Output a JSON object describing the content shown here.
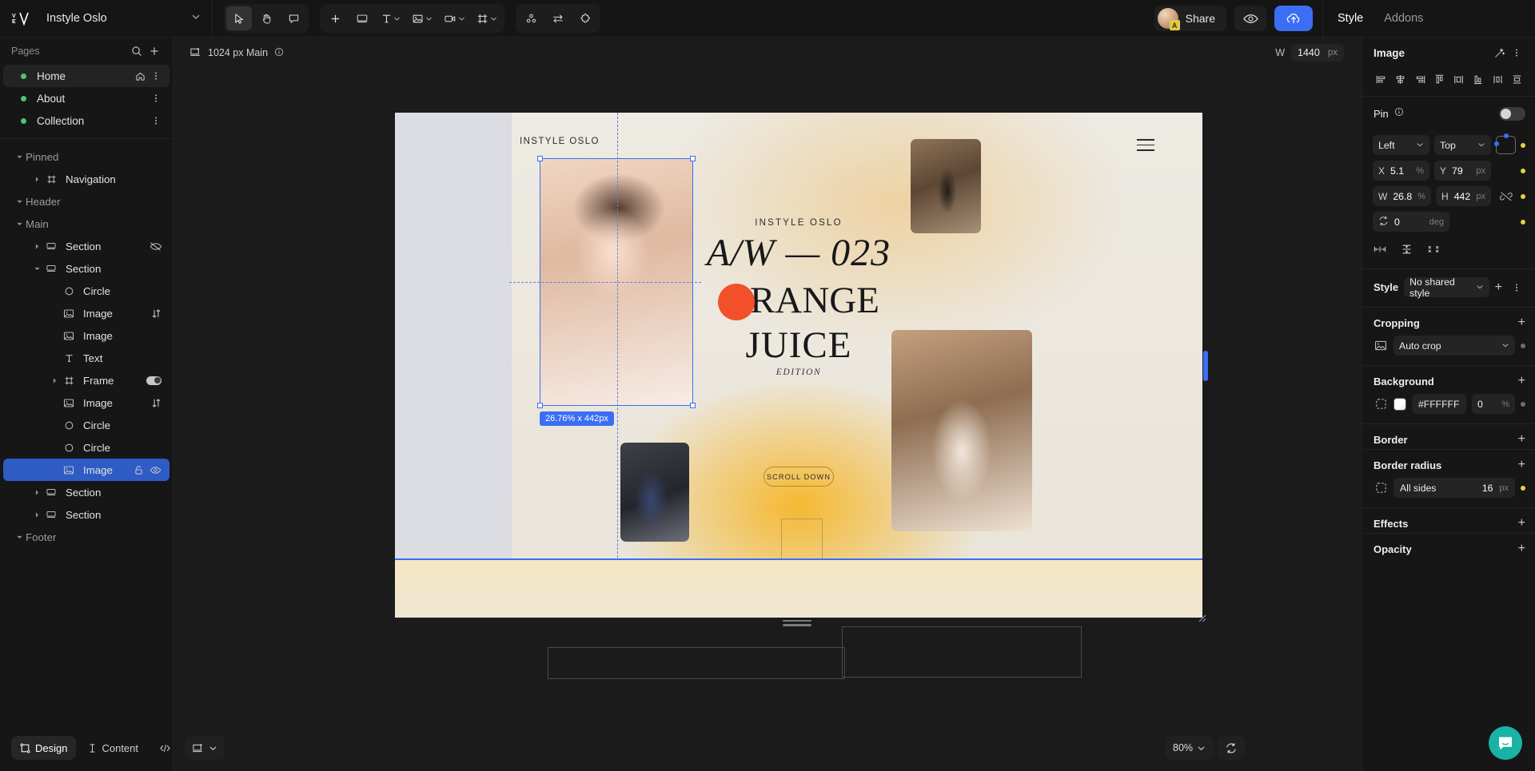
{
  "app": {
    "project_name": "Instyle Oslo",
    "logo_text": "V"
  },
  "toolbar": {
    "tools": [
      {
        "name": "select-tool",
        "icon": "cursor-icon",
        "active": true
      },
      {
        "name": "hand-tool",
        "icon": "hand-icon",
        "active": false
      },
      {
        "name": "comment-tool",
        "icon": "comment-icon",
        "active": false
      }
    ],
    "inserts": [
      {
        "name": "add-element-button",
        "icon": "plus-icon",
        "caret": false
      },
      {
        "name": "insert-section-button",
        "icon": "section-icon",
        "caret": false
      },
      {
        "name": "insert-text-button",
        "icon": "text-icon",
        "caret": true
      },
      {
        "name": "insert-image-button",
        "icon": "image-icon",
        "caret": true
      },
      {
        "name": "insert-video-button",
        "icon": "video-icon",
        "caret": true
      },
      {
        "name": "insert-frame-button",
        "icon": "frame-icon",
        "caret": true
      }
    ],
    "extras": [
      {
        "name": "components-button",
        "icon": "components-icon"
      },
      {
        "name": "interactions-button",
        "icon": "swap-arrows-icon"
      },
      {
        "name": "plugins-button",
        "icon": "puzzle-icon"
      }
    ],
    "share_label": "Share",
    "avatar_badge": "A",
    "preview_icon": "eye-icon",
    "publish_icon": "cloud-upload-icon"
  },
  "right_tabs": [
    {
      "label": "Style",
      "active": true
    },
    {
      "label": "Addons",
      "active": false
    }
  ],
  "sidebar": {
    "pages_label": "Pages",
    "search_icon": "search-icon",
    "add_icon": "plus-icon",
    "pages": [
      {
        "label": "Home",
        "selected": true,
        "home_icon": "home-icon",
        "menu_icon": "more-icon"
      },
      {
        "label": "About",
        "selected": false,
        "home_icon": "",
        "menu_icon": "more-icon"
      },
      {
        "label": "Collection",
        "selected": false,
        "home_icon": "",
        "menu_icon": "more-icon"
      }
    ],
    "layers": [
      {
        "label": "Pinned",
        "type": "group",
        "depth": 0,
        "caret": "down",
        "icon": "",
        "selected": false
      },
      {
        "label": "Navigation",
        "type": "frame",
        "depth": 1,
        "caret": "right",
        "icon": "frame-icon",
        "selected": false
      },
      {
        "label": "Header",
        "type": "group",
        "depth": 0,
        "caret": "down",
        "icon": "",
        "selected": false
      },
      {
        "label": "Main",
        "type": "group",
        "depth": 0,
        "caret": "down",
        "icon": "",
        "selected": false
      },
      {
        "label": "Section",
        "type": "layer",
        "depth": 1,
        "caret": "right",
        "icon": "section-icon",
        "selected": false,
        "tail": "hidden-icon"
      },
      {
        "label": "Section",
        "type": "layer",
        "depth": 1,
        "caret": "down",
        "icon": "section-icon",
        "selected": false
      },
      {
        "label": "Circle",
        "type": "layer",
        "depth": 2,
        "caret": "none",
        "icon": "circle-icon",
        "selected": false
      },
      {
        "label": "Image",
        "type": "layer",
        "depth": 2,
        "caret": "none",
        "icon": "image-icon",
        "selected": false,
        "tail": "swap-icon"
      },
      {
        "label": "Image",
        "type": "layer",
        "depth": 2,
        "caret": "none",
        "icon": "image-icon",
        "selected": false
      },
      {
        "label": "Text",
        "type": "layer",
        "depth": 2,
        "caret": "none",
        "icon": "text-icon",
        "selected": false
      },
      {
        "label": "Frame",
        "type": "layer",
        "depth": 2,
        "caret": "right",
        "icon": "frame-icon",
        "selected": false,
        "tail": "toggle-on"
      },
      {
        "label": "Image",
        "type": "layer",
        "depth": 2,
        "caret": "none",
        "icon": "image-icon",
        "selected": false,
        "tail": "swap-icon"
      },
      {
        "label": "Circle",
        "type": "layer",
        "depth": 2,
        "caret": "none",
        "icon": "circle-icon",
        "selected": false
      },
      {
        "label": "Circle",
        "type": "layer",
        "depth": 2,
        "caret": "none",
        "icon": "circle-icon",
        "selected": false
      },
      {
        "label": "Image",
        "type": "layer",
        "depth": 2,
        "caret": "none",
        "icon": "image-icon",
        "selected": true,
        "tail": "lock-eye"
      },
      {
        "label": "Section",
        "type": "layer",
        "depth": 1,
        "caret": "right",
        "icon": "section-icon",
        "selected": false
      },
      {
        "label": "Section",
        "type": "layer",
        "depth": 1,
        "caret": "right",
        "icon": "section-icon",
        "selected": false
      },
      {
        "label": "Footer",
        "type": "group",
        "depth": 0,
        "caret": "down",
        "icon": "",
        "selected": false
      }
    ],
    "bottom_tabs": [
      {
        "label": "Design",
        "icon": "design-icon",
        "active": true
      },
      {
        "label": "Content",
        "icon": "content-icon",
        "active": false
      },
      {
        "label": "Code",
        "icon": "code-icon",
        "active": false
      }
    ]
  },
  "canvas": {
    "breakpoint_label": "1024 px Main",
    "breakpoint_icon": "breakpoint-icon",
    "info_icon": "info-icon",
    "width_label": "W",
    "width_value": "1440",
    "width_unit": "px",
    "selection_size_badge": "26.76% x 442px",
    "zoom_level": "80%",
    "zoom_caret": "chevron-down-icon",
    "refresh_icon": "refresh-icon",
    "frame_picker_icon": "frame-picker-icon",
    "artboard": {
      "brand_small": "INSTYLE OSLO",
      "kicker": "INSTYLE OSLO",
      "headline_line1": "A/W — 023",
      "headline_line2": "RANGE",
      "headline_line3": "JUICE",
      "edition": "EDITION",
      "scroll_label": "SCROLL DOWN",
      "menu_icon": "hamburger-icon"
    }
  },
  "properties": {
    "section_title": "Image",
    "header_icons": [
      "magic-wand-icon",
      "more-icon"
    ],
    "align_icons": [
      "align-left-icon",
      "align-center-h-icon",
      "align-right-icon",
      "align-top-icon",
      "distribute-h-icon",
      "align-bottom-icon",
      "align-middle-v-icon",
      "distribute-v-icon"
    ],
    "pin": {
      "label": "Pin",
      "info_icon": "info-icon",
      "enabled": false
    },
    "position": {
      "h_anchor": "Left",
      "v_anchor": "Top",
      "x_label": "X",
      "x_value": "5.1",
      "x_unit": "%",
      "y_label": "Y",
      "y_value": "79",
      "y_unit": "px",
      "w_label": "W",
      "w_value": "26.8",
      "w_unit": "%",
      "h_label": "H",
      "h_value": "442",
      "h_unit": "px",
      "lock_ratio_icon": "link-off-icon",
      "rotation_icon": "rotate-icon",
      "rotation_value": "0",
      "rotation_unit": "deg"
    },
    "distribute_icons": [
      "spread-h-icon",
      "spread-v-icon",
      "pack-icon"
    ],
    "style": {
      "label": "Style",
      "value": "No shared style",
      "add_icon": "plus-icon",
      "more_icon": "more-icon"
    },
    "cropping": {
      "title": "Cropping",
      "add_icon": "plus-icon",
      "mode_icon": "image-icon",
      "mode": "Auto crop"
    },
    "background": {
      "title": "Background",
      "add_icon": "plus-icon",
      "swatch_icon": "dashed-square-icon",
      "color": "#FFFFFF",
      "opacity": "0",
      "opacity_unit": "%"
    },
    "border": {
      "title": "Border",
      "add_icon": "plus-icon"
    },
    "border_radius": {
      "title": "Border radius",
      "add_icon": "plus-icon",
      "swatch_icon": "dashed-square-icon",
      "sides_label": "All sides",
      "value": "16",
      "unit": "px"
    },
    "effects": {
      "title": "Effects",
      "add_icon": "plus-icon"
    },
    "opacity": {
      "title": "Opacity",
      "add_icon": "plus-icon"
    }
  },
  "helper": {
    "intercom_icon": "chat-icon"
  },
  "colors": {
    "accent_blue": "#3b6ef5",
    "selection_blue": "#2f5bc4",
    "page_dot_green": "#4ec17e",
    "orange_dot": "#f2502a",
    "intercom_teal": "#19b3a6",
    "yellow_dot": "#e0d24b"
  }
}
